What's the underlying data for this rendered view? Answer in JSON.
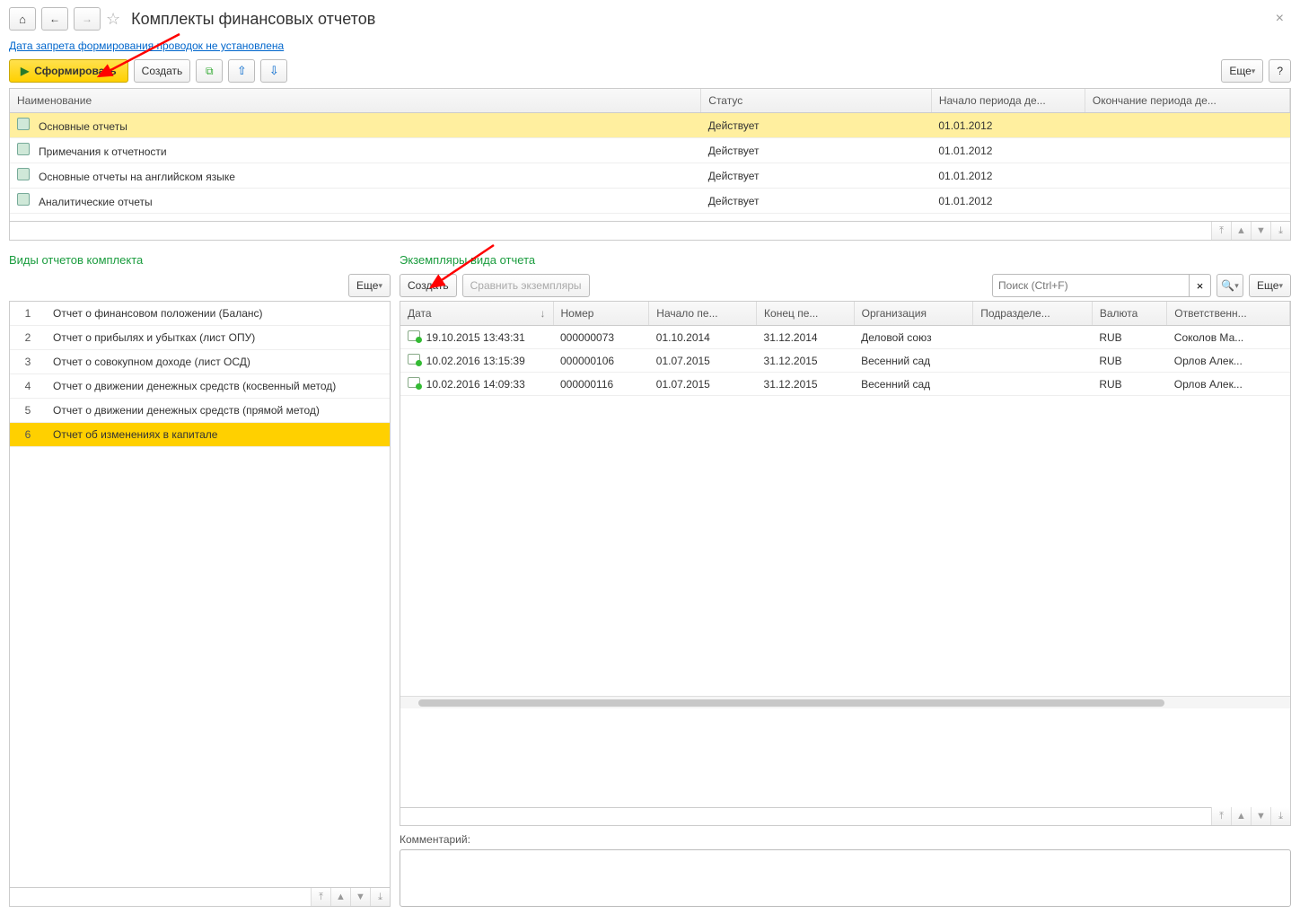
{
  "page_title": "Комплекты финансовых отчетов",
  "link_text": "Дата запрета формирования проводок не установлена",
  "buttons": {
    "generate": "Сформировать",
    "create": "Создать",
    "more": "Еще",
    "compare": "Сравнить экземпляры",
    "help": "?"
  },
  "top_table": {
    "columns": [
      "Наименование",
      "Статус",
      "Начало периода де...",
      "Окончание периода де..."
    ],
    "rows": [
      {
        "name": "Основные отчеты",
        "status": "Действует",
        "start": "01.01.2012",
        "end": "",
        "selected": true
      },
      {
        "name": "Примечания к отчетности",
        "status": "Действует",
        "start": "01.01.2012",
        "end": ""
      },
      {
        "name": "Основные отчеты на английском языке",
        "status": "Действует",
        "start": "01.01.2012",
        "end": ""
      },
      {
        "name": "Аналитические отчеты",
        "status": "Действует",
        "start": "01.01.2012",
        "end": ""
      }
    ]
  },
  "left_panel": {
    "title": "Виды отчетов комплекта",
    "rows": [
      {
        "n": "1",
        "name": "Отчет о финансовом положении (Баланс)"
      },
      {
        "n": "2",
        "name": "Отчет о прибылях и убытках  (лист ОПУ)"
      },
      {
        "n": "3",
        "name": "Отчет о совокупном доходе  (лист ОСД)"
      },
      {
        "n": "4",
        "name": "Отчет о движении денежных средств (косвенный метод)"
      },
      {
        "n": "5",
        "name": "Отчет о движении денежных средств (прямой метод)"
      },
      {
        "n": "6",
        "name": "Отчет об изменениях в капитале",
        "selected": true
      }
    ]
  },
  "right_panel": {
    "title": "Экземпляры вида отчета",
    "search_placeholder": "Поиск (Ctrl+F)",
    "columns": [
      "Дата",
      "Номер",
      "Начало пе...",
      "Конец пе...",
      "Организация",
      "Подразделе...",
      "Валюта",
      "Ответственн..."
    ],
    "rows": [
      {
        "date": "19.10.2015 13:43:31",
        "num": "000000073",
        "start": "01.10.2014",
        "end": "31.12.2014",
        "org": "Деловой союз",
        "dept": "",
        "cur": "RUB",
        "resp": "Соколов Ма..."
      },
      {
        "date": "10.02.2016 13:15:39",
        "num": "000000106",
        "start": "01.07.2015",
        "end": "31.12.2015",
        "org": "Весенний сад",
        "dept": "",
        "cur": "RUB",
        "resp": "Орлов Алек..."
      },
      {
        "date": "10.02.2016 14:09:33",
        "num": "000000116",
        "start": "01.07.2015",
        "end": "31.12.2015",
        "org": "Весенний сад",
        "dept": "",
        "cur": "RUB",
        "resp": "Орлов Алек..."
      }
    ],
    "comment_label": "Комментарий:"
  }
}
